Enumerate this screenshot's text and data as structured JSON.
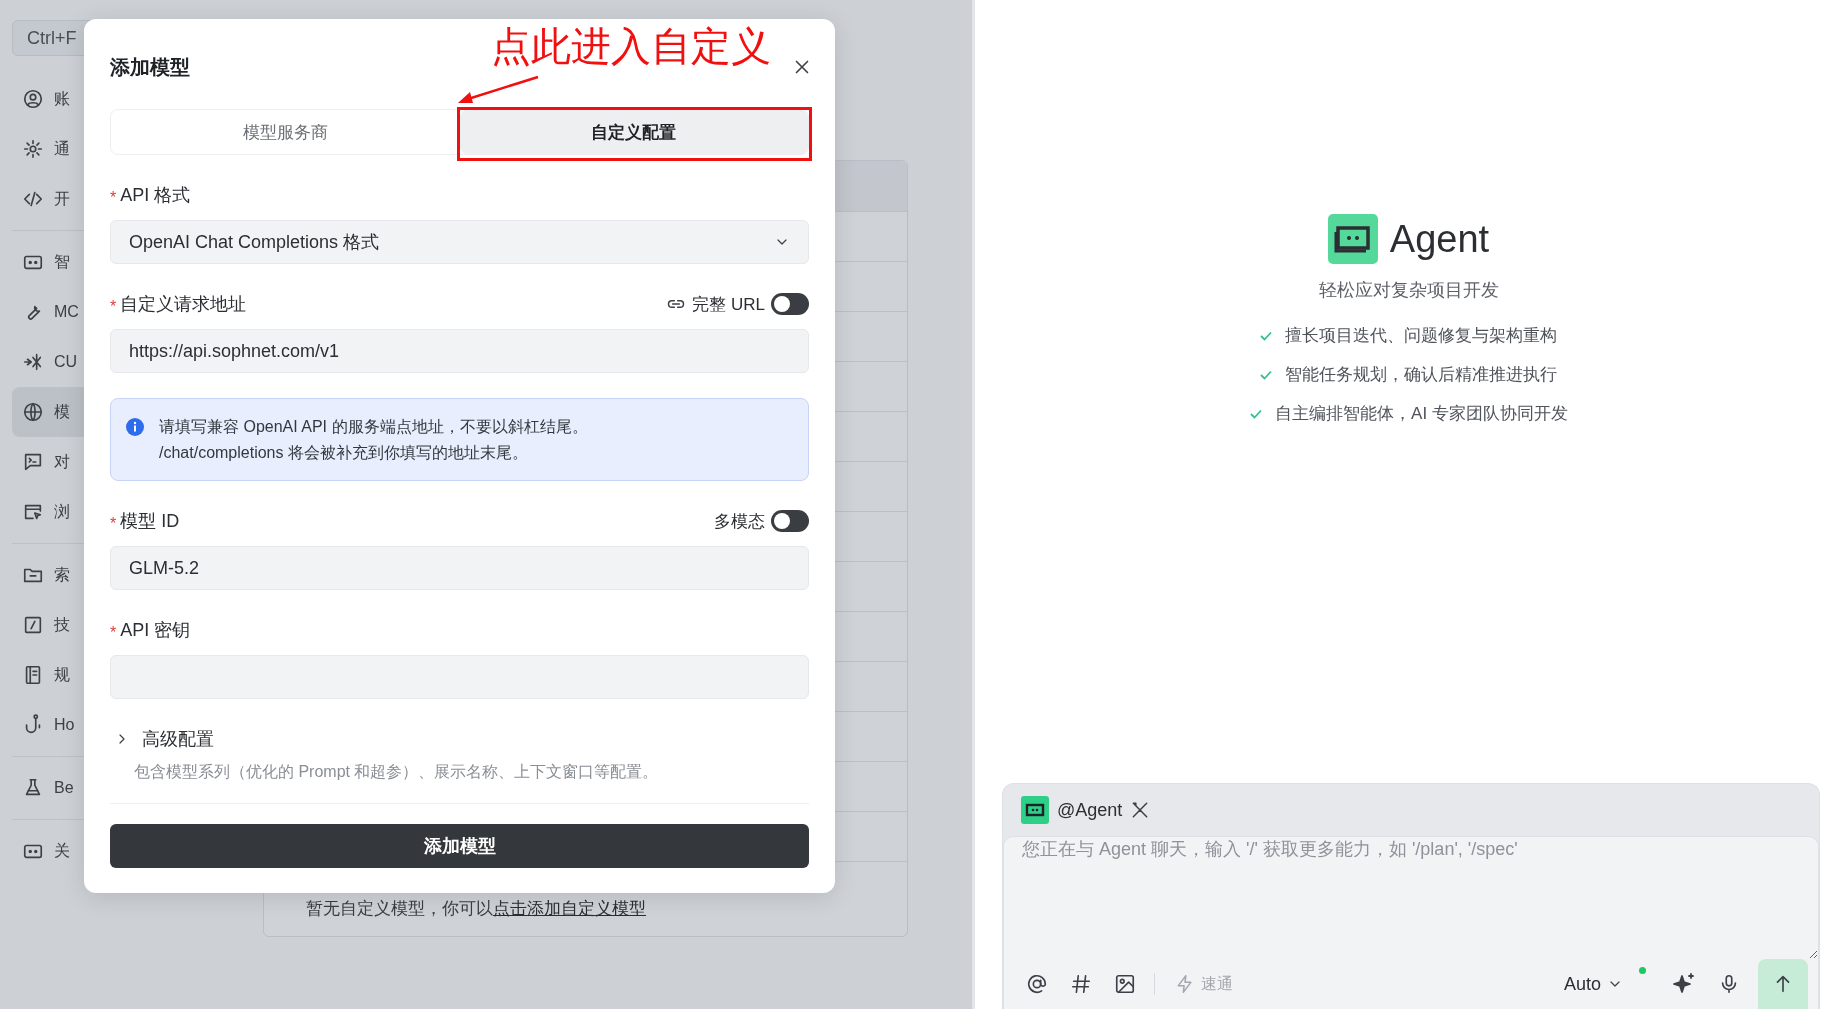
{
  "sidebar": {
    "shortcut": "Ctrl+F",
    "groups": [
      {
        "items": [
          {
            "label": "账",
            "selected": false
          },
          {
            "label": "通",
            "selected": false
          },
          {
            "label": "开",
            "selected": false
          }
        ]
      },
      {
        "items": [
          {
            "label": "智",
            "selected": false
          },
          {
            "label": "MC",
            "selected": false
          },
          {
            "label": "CU",
            "selected": false
          },
          {
            "label": "模",
            "selected": true
          },
          {
            "label": "对",
            "selected": false
          },
          {
            "label": "浏",
            "selected": false
          }
        ]
      },
      {
        "items": [
          {
            "label": "索",
            "selected": false
          },
          {
            "label": "技",
            "selected": false
          },
          {
            "label": "规",
            "selected": false
          },
          {
            "label": "Ho",
            "selected": false
          }
        ]
      },
      {
        "items": [
          {
            "label": "Be",
            "selected": false
          }
        ]
      },
      {
        "items": [
          {
            "label": "关",
            "selected": false
          }
        ]
      }
    ]
  },
  "models_panel": {
    "empty_text": "暂无自定义模型，你可以",
    "empty_link": "点击添加自定义模型"
  },
  "dialog": {
    "title": "添加模型",
    "tabs": [
      {
        "label": "模型服务商",
        "selected": false
      },
      {
        "label": "自定义配置",
        "selected": true
      }
    ],
    "fields": [
      {
        "kind": "select",
        "label": "API 格式",
        "mark": "*",
        "value": "OpenAI Chat Completions 格式"
      },
      {
        "kind": "text",
        "label": "自定义请求地址",
        "mark": "*",
        "value": "https://api.sophnet.com/v1",
        "toggle": {
          "label": "完整 URL",
          "on": false
        }
      },
      {
        "kind": "info",
        "lines": [
          "请填写兼容 OpenAI API 的服务端点地址，不要以斜杠结尾。",
          "/chat/completions 将会被补充到你填写的地址末尾。"
        ]
      },
      {
        "kind": "text",
        "label": "模型 ID",
        "mark": "*",
        "value": "GLM-5.2",
        "toggle": {
          "label": "多模态",
          "on": false
        }
      },
      {
        "kind": "text",
        "label": "API 密钥",
        "mark": "*"
      }
    ],
    "advanced": {
      "label": "高级配置",
      "expanded": false,
      "description": "包含模型系列（优化的 Prompt 和超参）、展示名称、上下文窗口等配置。"
    },
    "submit": "添加模型"
  },
  "annotation": {
    "text": "点此进入自定义"
  },
  "agent": {
    "name": "Agent",
    "subtitle": "轻松应对复杂项目开发",
    "features": [
      "擅长项目迭代、问题修复与架构重构",
      "智能任务规划，确认后精准推进执行",
      "自主编排智能体，AI 专家团队协同开发"
    ]
  },
  "chat": {
    "mention": "@Agent",
    "placeholder": "您正在与 Agent 聊天，输入 '/' 获取更多能力，如 '/plan', '/spec'",
    "quick_label": "速通",
    "quick_enabled": false,
    "model": "Auto",
    "model_online": true
  }
}
